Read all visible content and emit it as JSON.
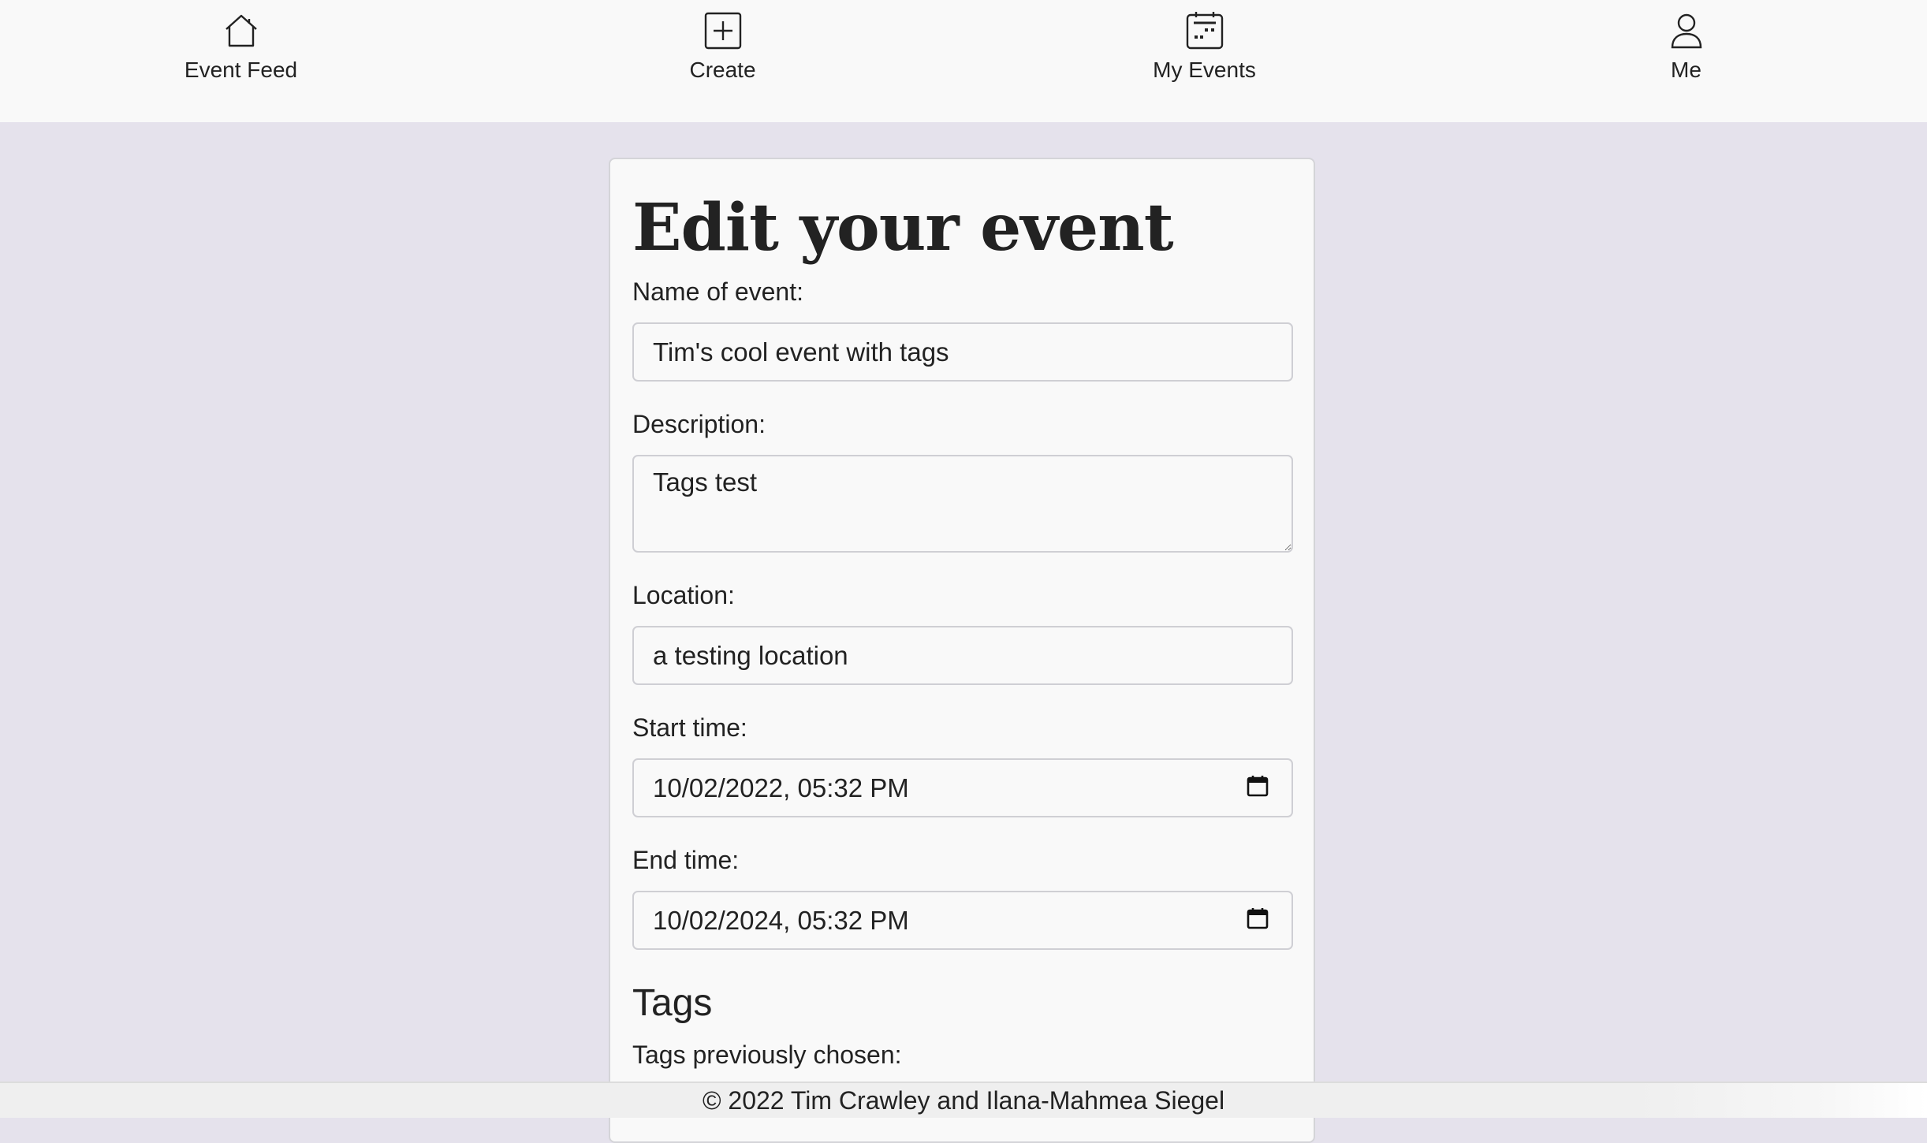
{
  "nav": {
    "items": [
      {
        "label": "Event Feed",
        "icon": "home-icon"
      },
      {
        "label": "Create",
        "icon": "plus-square-icon"
      },
      {
        "label": "My Events",
        "icon": "calendar-icon"
      },
      {
        "label": "Me",
        "icon": "person-icon"
      }
    ]
  },
  "form": {
    "title": "Edit your event",
    "name_label": "Name of event:",
    "name_value": "Tim's cool event with tags",
    "description_label": "Description:",
    "description_value": "Tags test",
    "location_label": "Location:",
    "location_value": "a testing location",
    "start_label": "Start time:",
    "start_value": "10/02/2022, 05:32  PM",
    "end_label": "End time:",
    "end_value": "10/02/2024, 05:32  PM",
    "tags_heading": "Tags",
    "tags_previous_label": "Tags previously chosen:"
  },
  "footer": {
    "text": "© 2022 Tim Crawley and Ilana-Mahmea Siegel"
  },
  "colors": {
    "background": "#e5e2ec",
    "nav_background": "#f9f9f9",
    "card_background": "#f9f9f9"
  }
}
